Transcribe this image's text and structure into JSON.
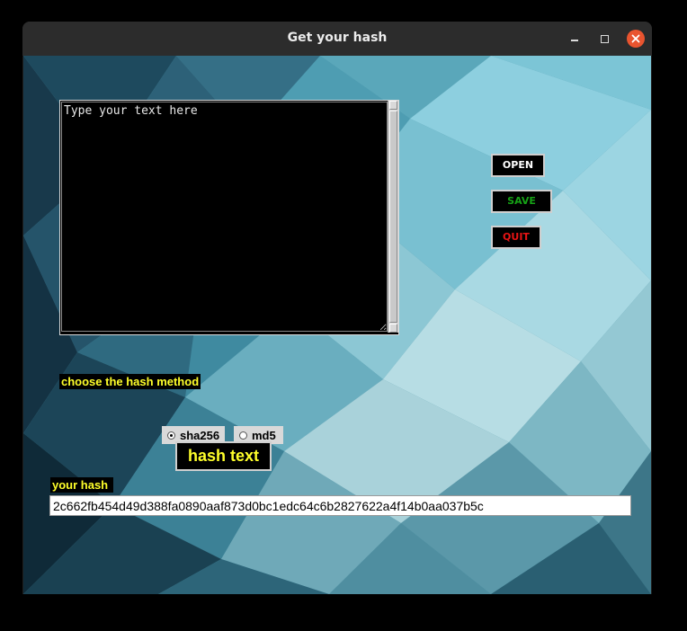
{
  "window": {
    "title": "Get your hash"
  },
  "editor": {
    "text": "Type your text here"
  },
  "buttons": {
    "open": "OPEN",
    "save": "SAVE",
    "quit": "QUIT"
  },
  "hash_method": {
    "label": "choose the hash method",
    "options": [
      {
        "label": "sha256",
        "selected": true
      },
      {
        "label": "md5",
        "selected": false
      }
    ]
  },
  "hash_button": "hash text",
  "output": {
    "label": "your hash",
    "value": "2c662fb454d49d388fa0890aaf873d0bc1edc64c6b2827622a4f14b0aa037b5c"
  },
  "colors": {
    "label_text": "#ffff2a",
    "save_text": "#16a316",
    "quit_text": "#e81414",
    "close_button": "#e9542f"
  }
}
